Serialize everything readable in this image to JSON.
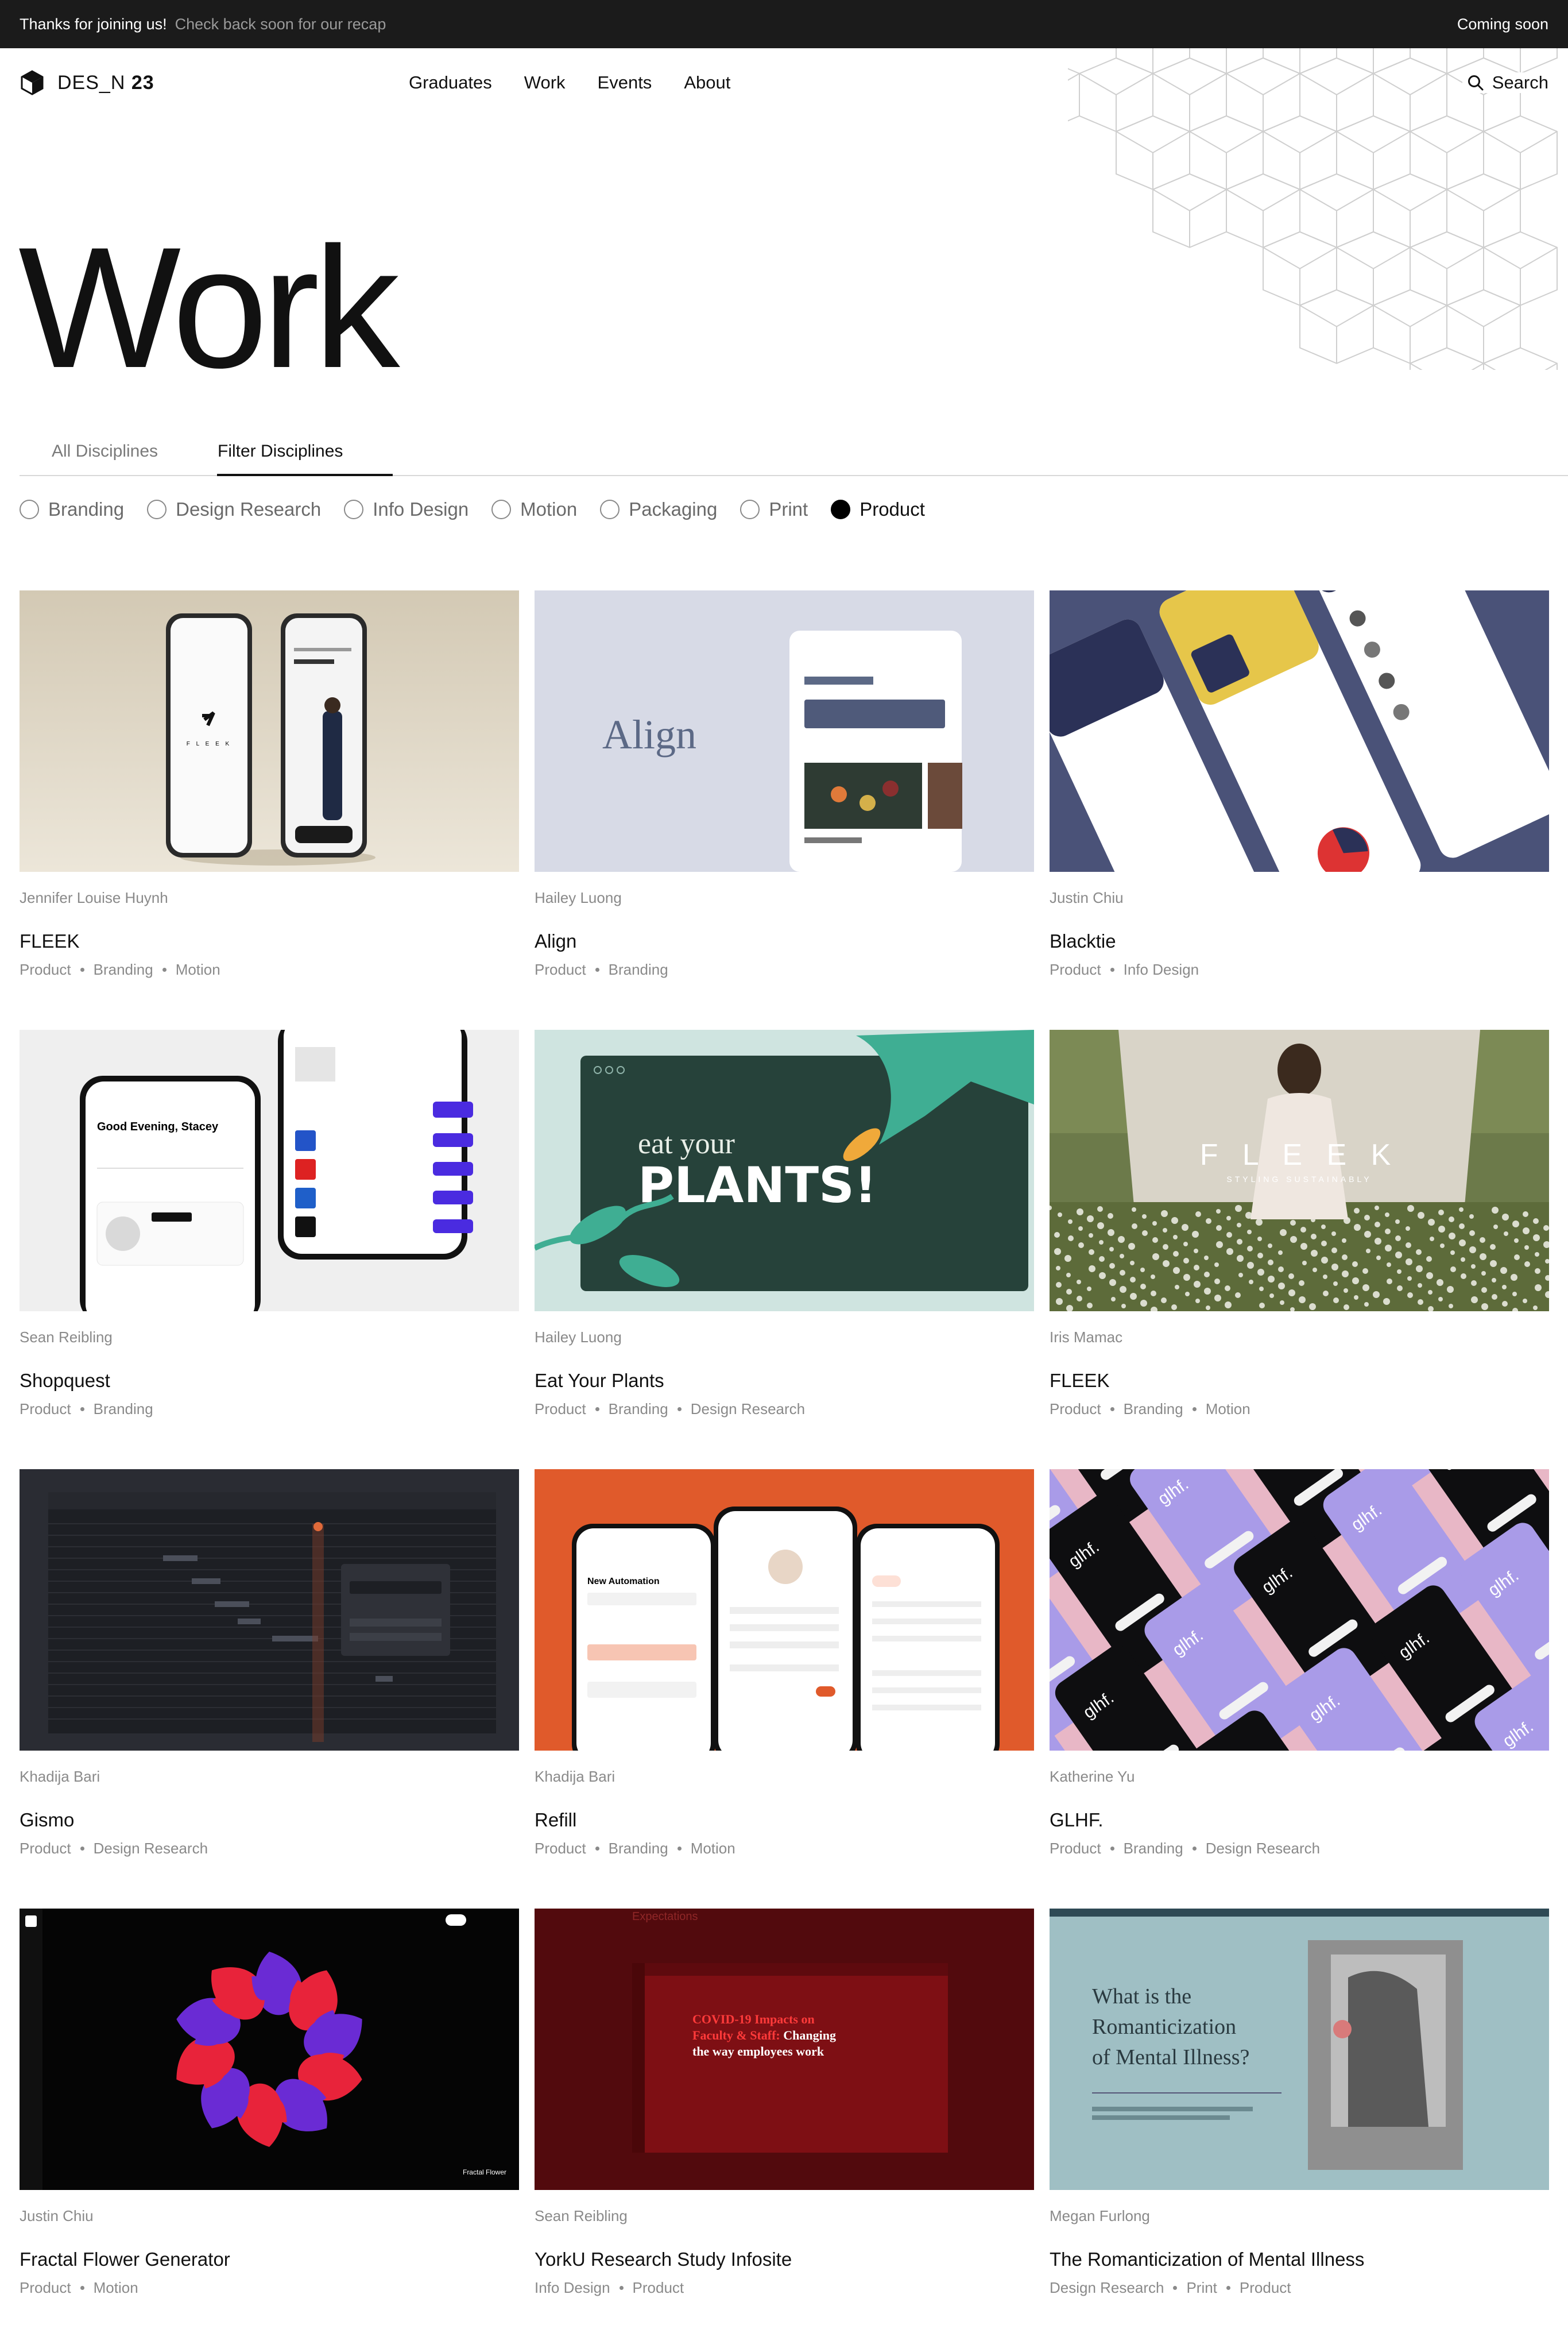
{
  "announcement": {
    "message": "Thanks for joining us!",
    "secondary": "Check back soon for our recap",
    "right": "Coming soon"
  },
  "header": {
    "logo_text": "DES_N",
    "logo_year": "23",
    "nav": [
      "Graduates",
      "Work",
      "Events",
      "About"
    ],
    "search_label": "Search"
  },
  "page_title": "Work",
  "tabs": [
    {
      "label": "All Disciplines",
      "active": false
    },
    {
      "label": "Filter Disciplines",
      "active": true
    }
  ],
  "filters": [
    {
      "label": "Branding",
      "selected": false
    },
    {
      "label": "Design Research",
      "selected": false
    },
    {
      "label": "Info Design",
      "selected": false
    },
    {
      "label": "Motion",
      "selected": false
    },
    {
      "label": "Packaging",
      "selected": false
    },
    {
      "label": "Print",
      "selected": false
    },
    {
      "label": "Product",
      "selected": true
    }
  ],
  "projects": [
    {
      "author": "Jennifer Louise Huynh",
      "title": "FLEEK",
      "tags": [
        "Product",
        "Branding",
        "Motion"
      ],
      "thumb_text": "F L E E K"
    },
    {
      "author": "Hailey Luong",
      "title": "Align",
      "tags": [
        "Product",
        "Branding"
      ],
      "thumb_text": "Align"
    },
    {
      "author": "Justin Chiu",
      "title": "Blacktie",
      "tags": [
        "Product",
        "Info Design"
      ],
      "thumb_text": ""
    },
    {
      "author": "Sean Reibling",
      "title": "Shopquest",
      "tags": [
        "Product",
        "Branding"
      ],
      "thumb_text": "Good Evening, Stacey"
    },
    {
      "author": "Hailey Luong",
      "title": "Eat Your Plants",
      "tags": [
        "Product",
        "Branding",
        "Design Research"
      ],
      "thumb_text": "eat your PLANTS!"
    },
    {
      "author": "Iris Mamac",
      "title": "FLEEK",
      "tags": [
        "Product",
        "Branding",
        "Motion"
      ],
      "thumb_text": "F L E E K"
    },
    {
      "author": "Khadija Bari",
      "title": "Gismo",
      "tags": [
        "Product",
        "Design Research"
      ],
      "thumb_text": ""
    },
    {
      "author": "Khadija Bari",
      "title": "Refill",
      "tags": [
        "Product",
        "Branding",
        "Motion"
      ],
      "thumb_text": "New Automation"
    },
    {
      "author": "Katherine Yu",
      "title": "GLHF.",
      "tags": [
        "Product",
        "Branding",
        "Design Research"
      ],
      "thumb_text": "glhf."
    },
    {
      "author": "Justin Chiu",
      "title": "Fractal Flower Generator",
      "tags": [
        "Product",
        "Motion"
      ],
      "thumb_text": ""
    },
    {
      "author": "Sean Reibling",
      "title": "YorkU Research Study Infosite",
      "tags": [
        "Info Design",
        "Product"
      ],
      "thumb_text": "COVID-19 Impacts on Faculty & Staff: Changing the way employees work"
    },
    {
      "author": "Megan Furlong",
      "title": "The Romanticization of Mental Illness",
      "tags": [
        "Design Research",
        "Print",
        "Product"
      ],
      "thumb_text": "What is the Romanticization of Mental Illness?"
    }
  ]
}
